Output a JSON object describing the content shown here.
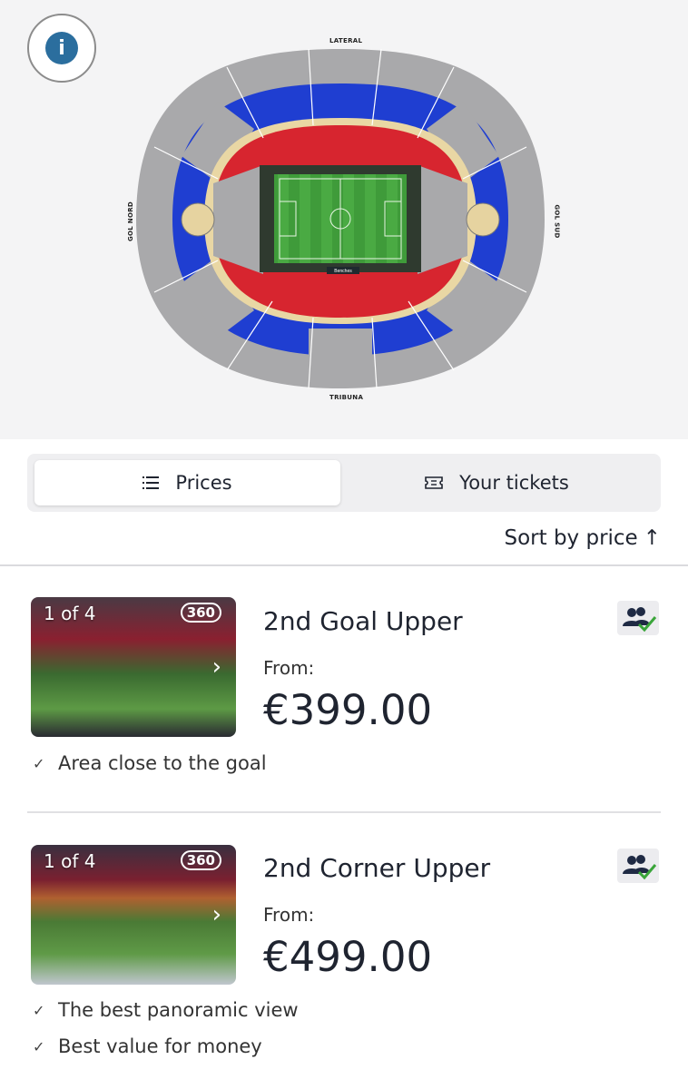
{
  "stadium_map": {
    "labels": {
      "top": "LATERAL",
      "bottom": "TRIBUNA",
      "left": "GOL NORD",
      "right": "GOL SUD",
      "benches": "Benches"
    },
    "colors": {
      "grey": "#a9a9ab",
      "blue": "#1f3ed1",
      "red": "#d7252f",
      "pitch": "#3f9b3a"
    }
  },
  "info_button": {
    "icon": "info-icon",
    "glyph": "i"
  },
  "tabs": [
    {
      "label": "Prices",
      "icon": "list-icon",
      "active": true
    },
    {
      "label": "Your tickets",
      "icon": "ticket-icon",
      "active": false
    }
  ],
  "sort": {
    "label": "Sort by price",
    "arrow": "↑"
  },
  "listings": [
    {
      "counter": "1 of 4",
      "pano": "360",
      "title": "2nd Goal Upper",
      "from": "From:",
      "price": "€399.00",
      "features": [
        "Area close to the goal"
      ]
    },
    {
      "counter": "1 of 4",
      "pano": "360",
      "title": "2nd Corner Upper",
      "from": "From:",
      "price": "€499.00",
      "features": [
        "The best panoramic view",
        "Best value for money"
      ]
    }
  ]
}
